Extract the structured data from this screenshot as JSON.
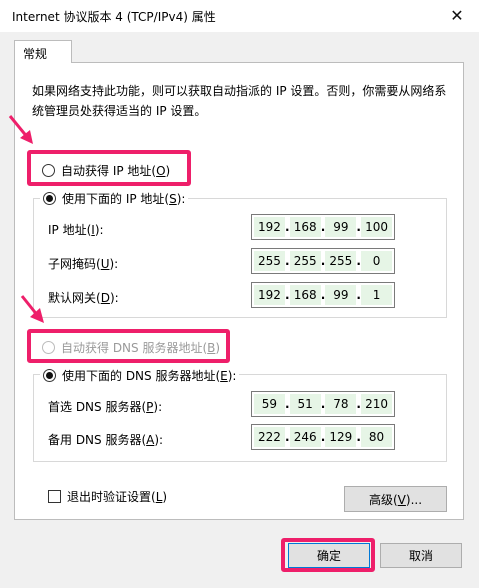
{
  "window": {
    "title": "Internet 协议版本 4 (TCP/IPv4) 属性",
    "close_glyph": "✕"
  },
  "tab": {
    "label": "常规"
  },
  "description": "如果网络支持此功能，则可以获取自动指派的 IP 设置。否则，你需要从网络系统管理员处获得适当的 IP 设置。",
  "ip_mode": {
    "auto_label": "自动获得 IP 地址(",
    "auto_key": "O",
    "auto_end": ")",
    "manual_label": "使用下面的 IP 地址(",
    "manual_key": "S",
    "manual_end": "):",
    "selected": "manual"
  },
  "ip_fields": {
    "ip": {
      "label": "IP 地址(",
      "key": "I",
      "end": "):",
      "octets": [
        "192",
        "168",
        "99",
        "100"
      ]
    },
    "mask": {
      "label": "子网掩码(",
      "key": "U",
      "end": "):",
      "octets": [
        "255",
        "255",
        "255",
        "0"
      ]
    },
    "gateway": {
      "label": "默认网关(",
      "key": "D",
      "end": "):",
      "octets": [
        "192",
        "168",
        "99",
        "1"
      ]
    }
  },
  "dns_mode": {
    "auto_label": "自动获得 DNS 服务器地址(",
    "auto_key": "B",
    "auto_end": ")",
    "manual_label": "使用下面的 DNS 服务器地址(",
    "manual_key": "E",
    "manual_end": "):",
    "selected": "manual",
    "auto_disabled": true
  },
  "dns_fields": {
    "preferred": {
      "label": "首选 DNS 服务器(",
      "key": "P",
      "end": "):",
      "octets": [
        "59",
        "51",
        "78",
        "210"
      ]
    },
    "alternate": {
      "label": "备用 DNS 服务器(",
      "key": "A",
      "end": "):",
      "octets": [
        "222",
        "246",
        "129",
        "80"
      ]
    }
  },
  "validate": {
    "label": "退出时验证设置(",
    "key": "L",
    "end": ")",
    "checked": false
  },
  "buttons": {
    "advanced": {
      "label": "高级(",
      "key": "V",
      "end": ")..."
    },
    "ok": "确定",
    "cancel": "取消"
  },
  "colors": {
    "highlight": "#ee1f6a",
    "octet_fill": "#e6f5e6",
    "dialog_bg": "#f0f0f0"
  }
}
